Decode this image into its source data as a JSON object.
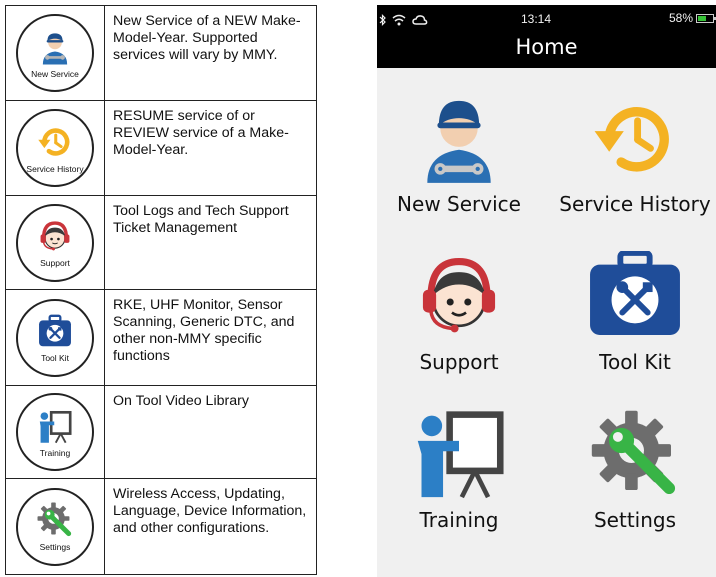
{
  "legend": {
    "rows": [
      {
        "id": "new-service",
        "icon": "mechanic-icon",
        "label": "New Service",
        "description": "New Service of a NEW Make-Model-Year. Supported services will vary by MMY."
      },
      {
        "id": "service-history",
        "icon": "history-clock-icon",
        "label": "Service History",
        "description": "RESUME service of or REVIEW service of a Make-Model-Year."
      },
      {
        "id": "support",
        "icon": "support-headset-icon",
        "label": "Support",
        "description": "Tool Logs and Tech Support Ticket Management"
      },
      {
        "id": "tool-kit",
        "icon": "toolbox-icon",
        "label": "Tool Kit",
        "description": "RKE, UHF Monitor, Sensor Scanning, Generic DTC, and other non-MMY specific functions"
      },
      {
        "id": "training",
        "icon": "training-presenter-icon",
        "label": "Training",
        "description": "On Tool Video Library"
      },
      {
        "id": "settings",
        "icon": "settings-gear-wrench-icon",
        "label": "Settings",
        "description": "Wireless Access, Updating, Language, Device Information, and other configurations."
      }
    ]
  },
  "phone": {
    "status_bar": {
      "time": "13:14",
      "battery_percent": "58%",
      "battery_level": 0.58,
      "icons": [
        "bluetooth-icon",
        "wifi-icon",
        "cloud-icon"
      ]
    },
    "title": "Home",
    "tiles": [
      {
        "label": "New Service",
        "icon": "mechanic-icon"
      },
      {
        "label": "Service History",
        "icon": "history-clock-icon"
      },
      {
        "label": "Support",
        "icon": "support-headset-icon"
      },
      {
        "label": "Tool Kit",
        "icon": "toolbox-icon"
      },
      {
        "label": "Training",
        "icon": "training-presenter-icon"
      },
      {
        "label": "Settings",
        "icon": "settings-gear-wrench-icon"
      }
    ]
  },
  "colors": {
    "mechanic_blue": "#2a6fb3",
    "history_orange": "#f4b223",
    "support_red": "#c9343a",
    "toolbox_navy": "#1f4d99",
    "training_blue": "#2c7fc6",
    "settings_gray": "#6d6d6d",
    "settings_green": "#38b446",
    "phone_background": "#f0f0f0",
    "header_background": "#000000",
    "battery_green": "#37c237"
  }
}
